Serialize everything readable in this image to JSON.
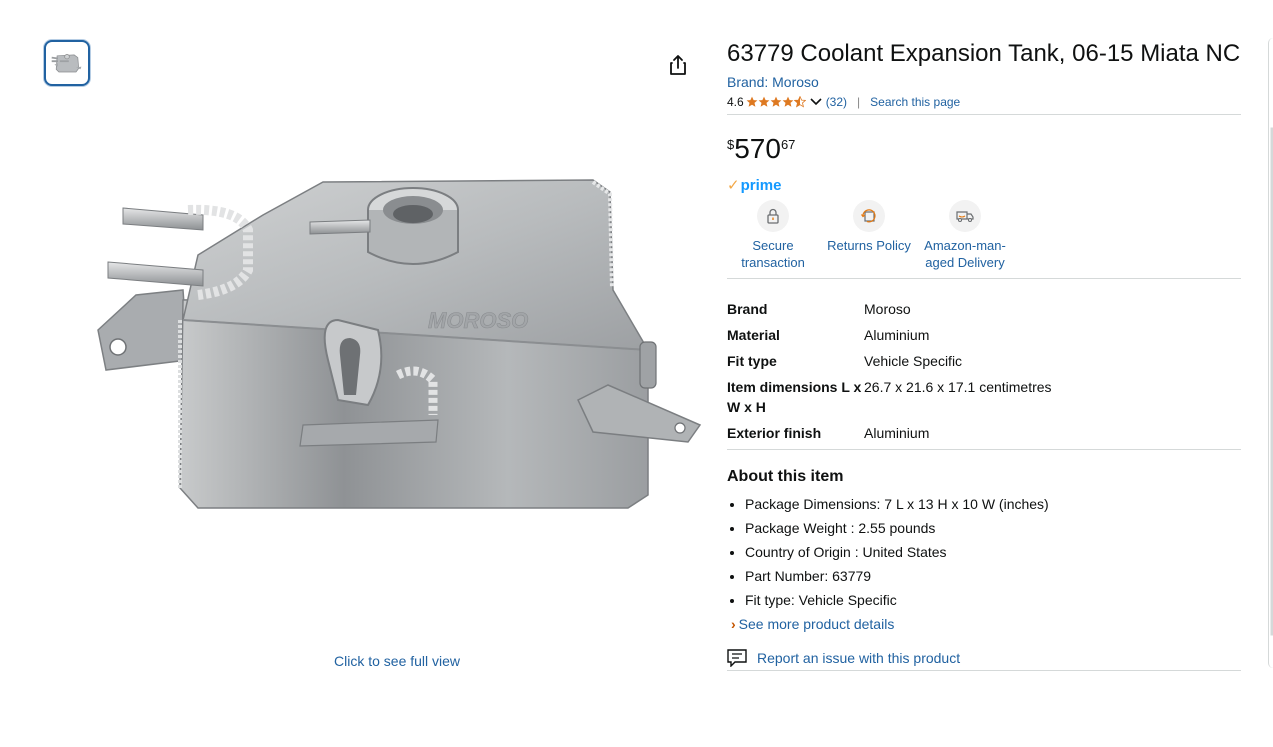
{
  "title": "63779 Coolant Expansion Tank, 06-15 Miata NC",
  "brand_link": "Brand: Moroso",
  "rating": {
    "value": "4.6",
    "stars": 4.5,
    "count": "(32)"
  },
  "search_page": "Search this page",
  "price": {
    "symbol": "$",
    "whole": "570",
    "fraction": "67"
  },
  "prime": {
    "check": "✓",
    "label": "prime"
  },
  "badges": [
    {
      "icon": "lock-icon",
      "label": "Secure transaction"
    },
    {
      "icon": "returns-icon",
      "label": "Returns Policy"
    },
    {
      "icon": "delivery-van-icon",
      "label": "Amazon-man-aged Delivery"
    }
  ],
  "badge_lines": {
    "secure_1": "Secure",
    "secure_2": "transaction",
    "amazon_1": "Amazon-man-",
    "amazon_2": "aged Delivery"
  },
  "specs": [
    {
      "key": "Brand",
      "value": "Moroso"
    },
    {
      "key": "Material",
      "value": "Aluminium"
    },
    {
      "key": "Fit type",
      "value": "Vehicle Specific"
    },
    {
      "key": "Item dimensions L x W x H",
      "value": "26.7 x 21.6 x 17.1 centimetres"
    },
    {
      "key": "Exterior finish",
      "value": "Aluminium"
    }
  ],
  "spec_key_lines": {
    "dims_1": "Item dimensions L x",
    "dims_2": "W x H"
  },
  "about": {
    "heading": "About this item",
    "bullets": [
      "Package Dimensions: 7 L x 13 H x 10 W (inches)",
      "Package Weight : 2.55 pounds",
      "Country of Origin : United States",
      "Part Number: 63779",
      "Fit type: Vehicle Specific"
    ],
    "see_more": "See more product details"
  },
  "report": "Report an issue with this product",
  "image": {
    "full_view": "Click to see full view",
    "embossed_logo": "MOROSO"
  },
  "colors": {
    "link": "#2162a1",
    "prime": "#1399ff",
    "star": "#de7921",
    "accent_chevron": "#c45500"
  }
}
